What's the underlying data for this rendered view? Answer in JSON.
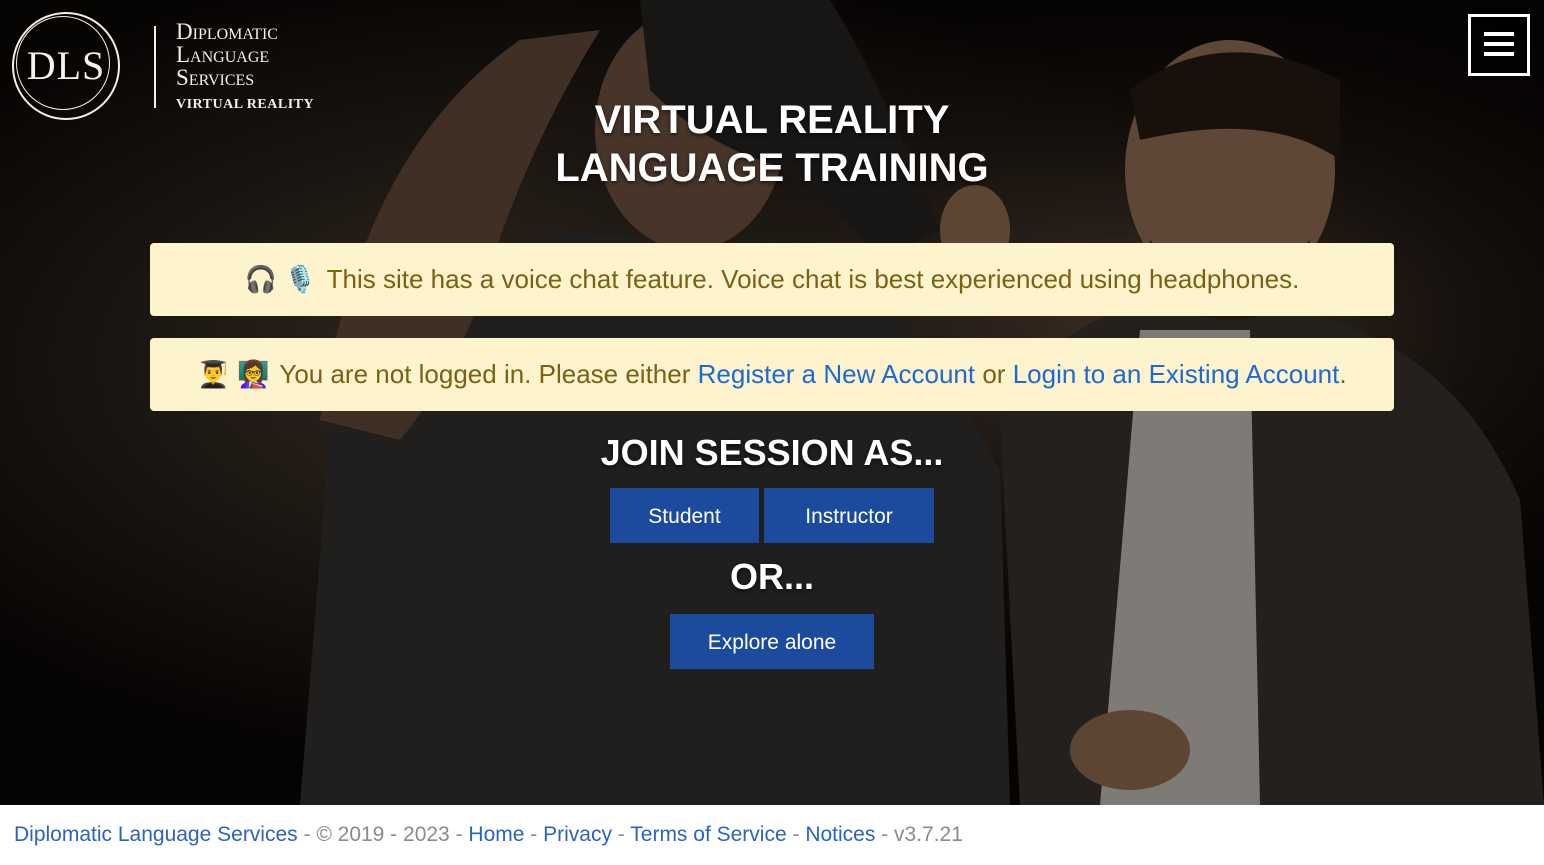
{
  "logo": {
    "initials": "DLS",
    "line1": "Diplomatic",
    "line2": "Language",
    "line3": "Services",
    "subtitle": "VIRTUAL REALITY"
  },
  "header": {
    "menu_icon": "hamburger-menu-icon"
  },
  "hero": {
    "title_line1": "VIRTUAL REALITY",
    "title_line2": "LANGUAGE TRAINING"
  },
  "alerts": {
    "voice": {
      "icons": "🎧 🎙️",
      "text": "This site has a voice chat feature. Voice chat is best experienced using headphones."
    },
    "login": {
      "icons": "👨‍🎓 👩‍🏫",
      "prefix": "You are not logged in. Please either",
      "register_link": "Register a New Account",
      "or": "or",
      "login_link": "Login to an Existing Account",
      "suffix": "."
    }
  },
  "join": {
    "title": "JOIN SESSION AS...",
    "student_label": "Student",
    "instructor_label": "Instructor",
    "or_text": "OR...",
    "explore_label": "Explore alone"
  },
  "footer": {
    "company_link": "Diplomatic Language Services",
    "sep1": " - ",
    "copyright": "© 2019 - 2023",
    "sep2": " - ",
    "home_link": "Home",
    "sep3": " - ",
    "privacy_link": "Privacy",
    "sep4": " - ",
    "terms_link": "Terms of Service",
    "sep5": " - ",
    "notices_link": "Notices",
    "sep6": " - ",
    "version": "v3.7.21"
  },
  "colors": {
    "alert_bg": "#fdf3cd",
    "alert_text": "#7b6213",
    "link": "#1d6ad1",
    "button_bg": "#1c4a9c"
  }
}
